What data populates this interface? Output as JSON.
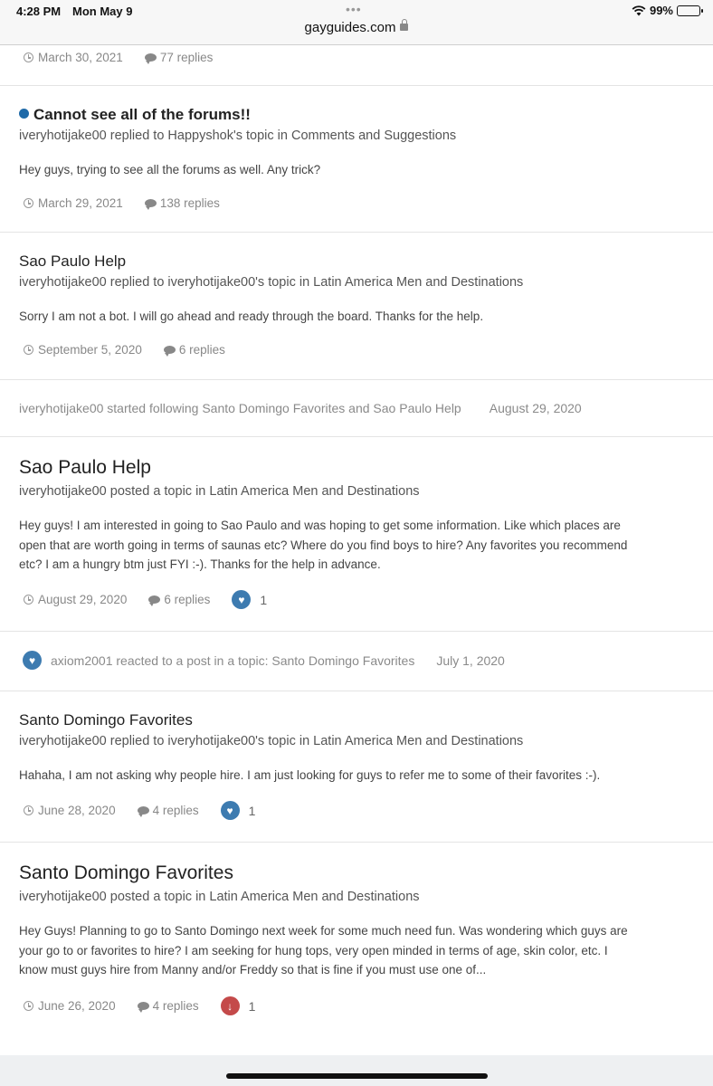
{
  "status": {
    "time": "4:28 PM",
    "date": "Mon May 9",
    "battery": "99%",
    "battery_level": 0.99
  },
  "browser": {
    "url": "gayguides.com"
  },
  "feed": [
    {
      "date": "March 30, 2021",
      "replies": "77 replies"
    },
    {
      "title": "Cannot see all of the forums!!",
      "sub": "iveryhotijake00 replied to Happyshok's topic in Comments and Suggestions",
      "body": "Hey guys, trying to see all the forums as well. Any trick?",
      "date": "March 29, 2021",
      "replies": "138 replies"
    },
    {
      "title": "Sao Paulo Help",
      "sub": "iveryhotijake00 replied to iveryhotijake00's topic in Latin America Men and Destinations",
      "body": "Sorry I am not a bot. I will go ahead and ready through the board. Thanks for the help.",
      "date": "September 5, 2020",
      "replies": "6 replies"
    },
    {
      "activity": "iveryhotijake00 started following Santo Domingo Favorites and Sao Paulo Help",
      "date": "August 29, 2020"
    },
    {
      "title": "Sao Paulo Help",
      "sub": "iveryhotijake00 posted a topic in Latin America Men and Destinations",
      "body": [
        "Hey guys! I am interested in going to Sao Paulo and was hoping to get some information. Like which places are",
        "open that are worth going in terms of saunas etc? Where do you find boys to hire? Any favorites you recommend",
        "etc? I am a hungry btm just FYI :-). Thanks for the help in advance."
      ],
      "date": "August 29, 2020",
      "replies": "6 replies",
      "reactions": "1"
    },
    {
      "activity": "axiom2001 reacted to a post in a topic: Santo Domingo Favorites",
      "date": "July 1, 2020"
    },
    {
      "title": "Santo Domingo Favorites",
      "sub": "iveryhotijake00 replied to iveryhotijake00's topic in Latin America Men and Destinations",
      "body": "Hahaha, I am not asking why people hire. I am just looking for guys to refer me to some of their favorites :-).",
      "date": "June 28, 2020",
      "replies": "4 replies",
      "reactions": "1"
    },
    {
      "title": "Santo Domingo Favorites",
      "sub": "iveryhotijake00 posted a topic in Latin America Men and Destinations",
      "body": [
        "Hey Guys! Planning to go to Santo Domingo next week for some much need fun. Was wondering which guys are",
        "your go to or favorites to hire? I am seeking for hung tops, very open minded in terms of age, skin color, etc. I",
        "know must guys hire from Manny and/or Freddy so that is fine if you must use one of..."
      ],
      "date": "June 26, 2020",
      "replies": "4 replies",
      "reactions": "1"
    }
  ]
}
